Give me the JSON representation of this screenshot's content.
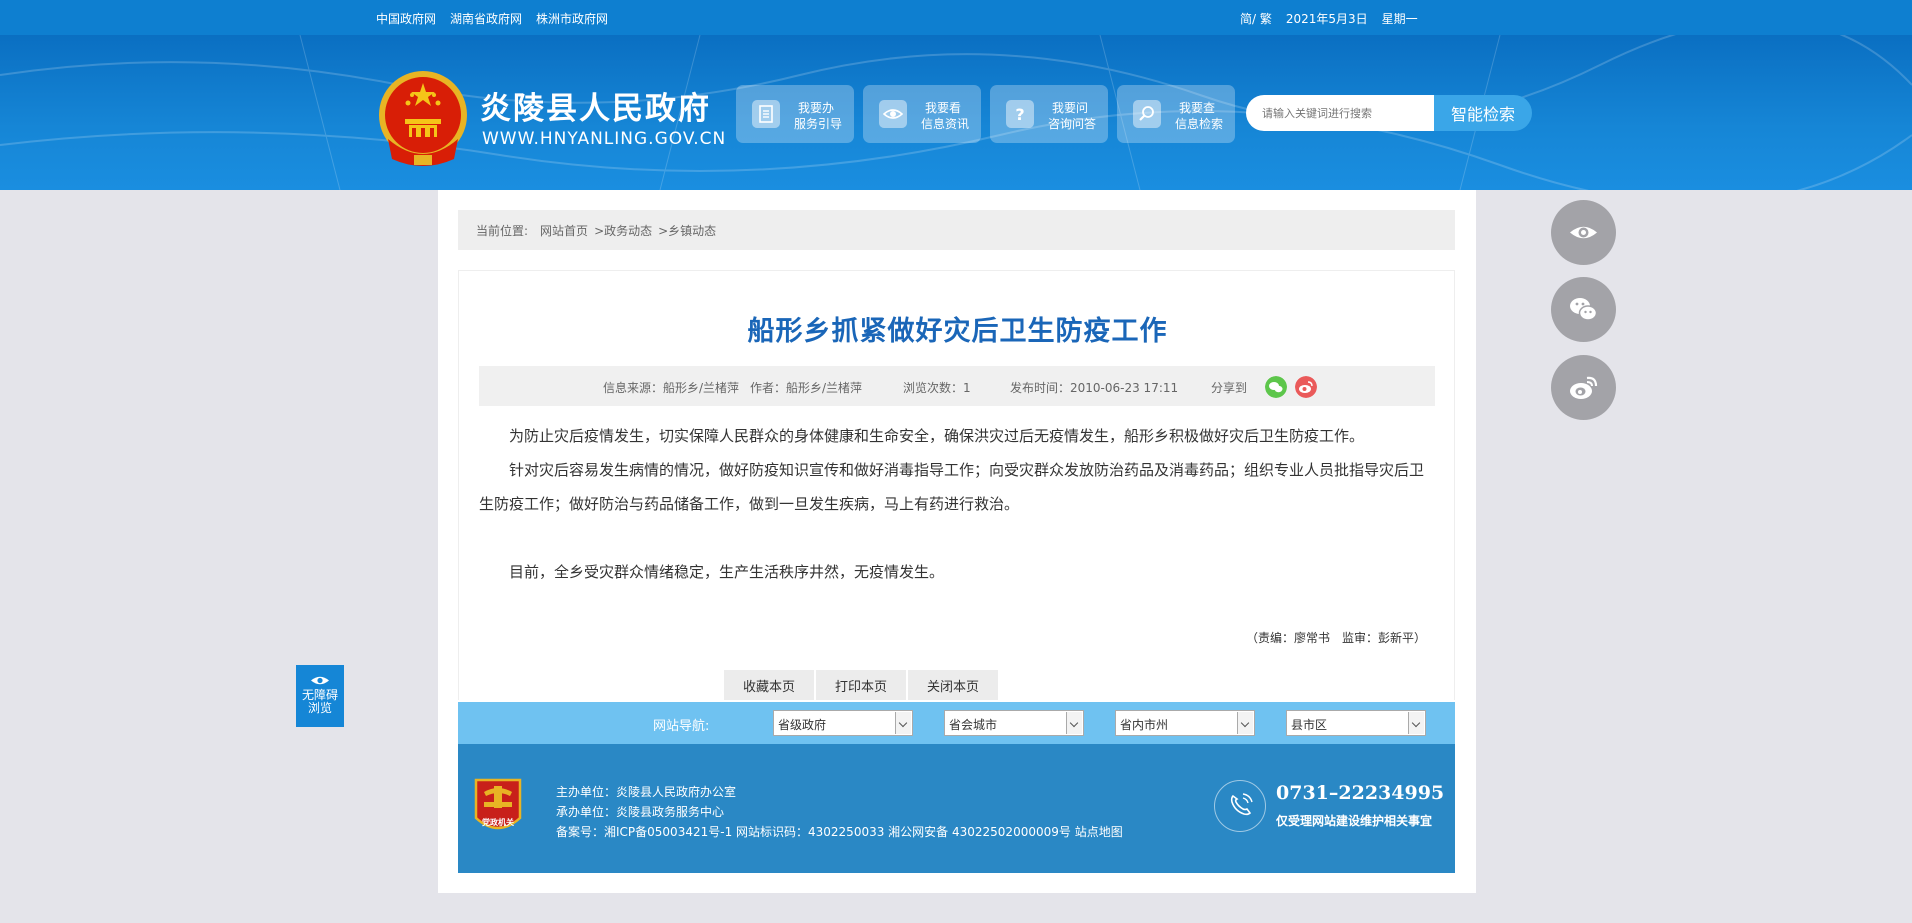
{
  "topbar": {
    "links": [
      "中国政府网",
      "湖南省政府网",
      "株洲市政府网"
    ],
    "lang": "简/ 繁",
    "date": "2021年5月3日",
    "weekday": "星期一"
  },
  "header": {
    "site_name": "炎陵县人民政府",
    "site_url": "WWW.HNYANLING.GOV.CN",
    "services": [
      {
        "line1": "我要办",
        "line2": "服务引导",
        "icon": "document-icon"
      },
      {
        "line1": "我要看",
        "line2": "信息资讯",
        "icon": "eye-icon"
      },
      {
        "line1": "我要问",
        "line2": "咨询问答",
        "icon": "question-icon"
      },
      {
        "line1": "我要查",
        "line2": "信息检索",
        "icon": "search-icon"
      }
    ],
    "search_placeholder": "请输入关键词进行搜索",
    "search_button": "智能检索"
  },
  "breadcrumb": {
    "prefix": "当前位置:",
    "items": [
      "网站首页",
      ">政务动态",
      ">乡镇动态"
    ]
  },
  "article": {
    "title": "船形乡抓紧做好灾后卫生防疫工作",
    "meta": {
      "source": "信息来源：船形乡/兰楮萍",
      "author": "作者：船形乡/兰楮萍",
      "views": "浏览次数：1",
      "published": "发布时间：2010-06-23 17:11",
      "share": "分享到"
    },
    "paragraphs": [
      "为防止灾后疫情发生，切实保障人民群众的身体健康和生命安全，确保洪灾过后无疫情发生，船形乡积极做好灾后卫生防疫工作。",
      "针对灾后容易发生病情的情况，做好防疫知识宣传和做好消毒指导工作；向受灾群众发放防治药品及消毒药品；组织专业人员批指导灾后卫生防疫工作；做好防治与药品储备工作，做到一旦发生疾病，马上有药进行救治。",
      "目前，全乡受灾群众情绪稳定，生产生活秩序井然，无疫情发生。"
    ],
    "editor": "（责编：廖常书　监审：彭新平）"
  },
  "actions": [
    "收藏本页",
    "打印本页",
    "关闭本页"
  ],
  "site_nav": {
    "label": "网站导航:",
    "selects": [
      "省级政府",
      "省会城市",
      "省内市州",
      "县市区"
    ]
  },
  "footer": {
    "sponsor": "主办单位：炎陵县人民政府办公室",
    "organizer": "承办单位：炎陵县政务服务中心",
    "record": "备案号：湘ICP备05003421号-1 网站标识码：4302250033 湘公网安备 43022502000009号 站点地图",
    "badge_text": "党政机关",
    "phone": "0731–22234995",
    "phone_note": "仅受理网站建设维护相关事宜"
  },
  "accessibility": {
    "line1": "无障碍",
    "line2": "浏览"
  },
  "colors": {
    "brand_blue": "#0e7fd0",
    "title_blue": "#1a66b8",
    "nav_blue": "#6fc2f1",
    "footer_blue": "#2a88c5"
  }
}
